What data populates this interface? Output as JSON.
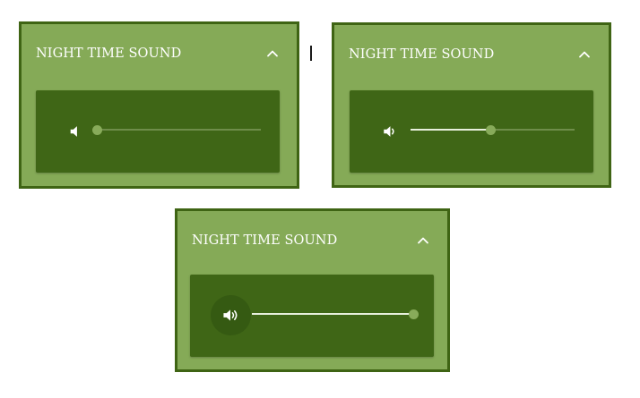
{
  "panels": [
    {
      "id": "muted",
      "title": "NIGHT TIME SOUND",
      "collapse_icon": "chevron-up-icon",
      "volume_icon": "volume-muted-icon",
      "volume_level": 0.0
    },
    {
      "id": "half",
      "title": "NIGHT TIME SOUND",
      "collapse_icon": "chevron-up-icon",
      "volume_icon": "volume-low-icon",
      "volume_level": 0.49
    },
    {
      "id": "full",
      "title": "NIGHT TIME SOUND",
      "collapse_icon": "chevron-up-icon",
      "volume_icon": "volume-high-icon",
      "volume_level": 1.0
    }
  ],
  "colors": {
    "panel_background": "#85aa57",
    "panel_border": "#3f6414",
    "sound_box_background": "#3f6616",
    "slider_fill": "#e8f0dd",
    "slider_thumb": "#88ab5a"
  }
}
